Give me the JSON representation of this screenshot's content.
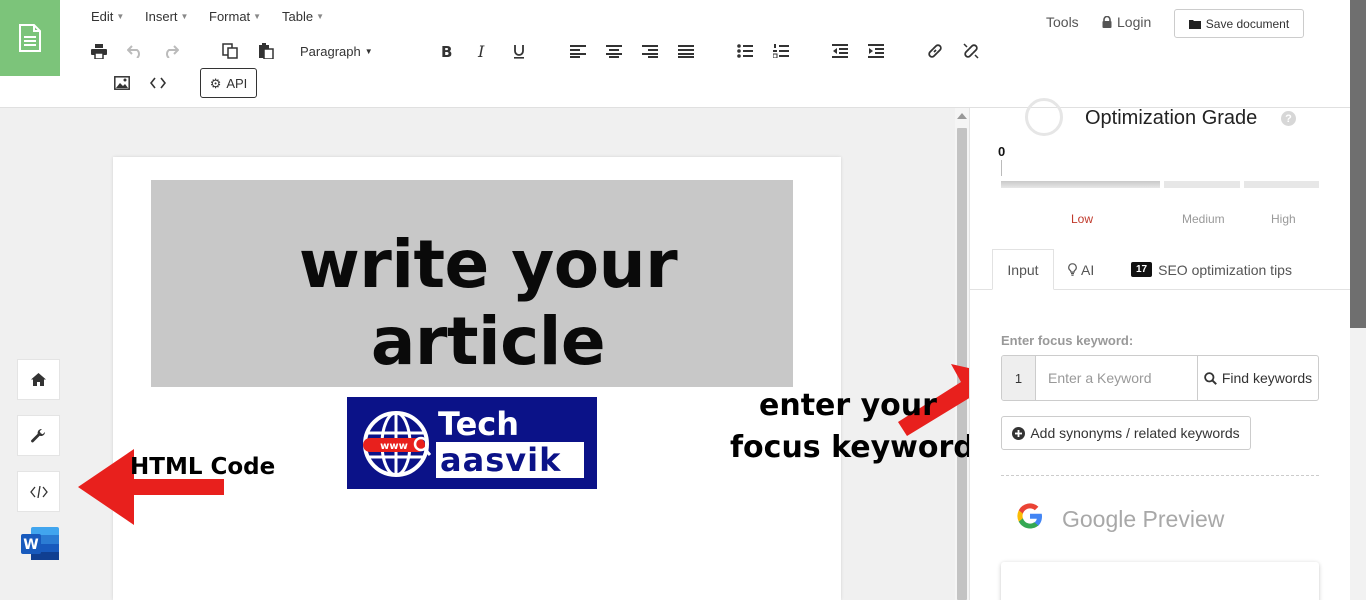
{
  "menu": {
    "edit": "Edit",
    "insert": "Insert",
    "format": "Format",
    "table": "Table"
  },
  "toolbar": {
    "paragraph": "Paragraph",
    "api_label": "API"
  },
  "header": {
    "tools": "Tools",
    "login": "Login",
    "save_document": "Save document"
  },
  "editor": {
    "banner_text": "write your article",
    "logo_line1": "Tech",
    "logo_line2": "aasvik",
    "logo_badge": "www"
  },
  "annotations": {
    "html_code": "HTML Code",
    "focus_line1": "enter your",
    "focus_line2": "focus keyword"
  },
  "grade": {
    "title": "Optimization Grade",
    "help": "?",
    "value": "0",
    "levels": [
      "Low",
      "Medium",
      "High"
    ]
  },
  "tabs": {
    "input": "Input",
    "ai": "AI",
    "seo_count": "17",
    "seo": "SEO optimization tips"
  },
  "keyword": {
    "label": "Enter focus keyword:",
    "index": "1",
    "placeholder": "Enter a Keyword",
    "find": "Find keywords",
    "add_synonyms": "Add synonyms / related keywords"
  },
  "preview": {
    "title": "Google Preview"
  },
  "colors": {
    "accent_green": "#7cc47a",
    "arrow_red": "#e8201d",
    "brand_blue": "#0b1288",
    "low_red": "#c0392b"
  }
}
